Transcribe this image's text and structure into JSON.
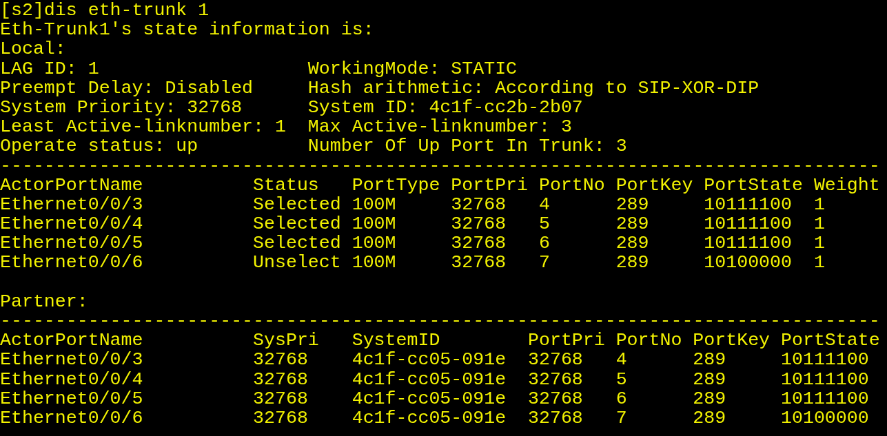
{
  "command": "[s2]dis eth-trunk 1",
  "header": "Eth-Trunk1's state information is:",
  "local_label": "Local:",
  "info": [
    {
      "left": "LAG ID: 1",
      "right": "WorkingMode: STATIC"
    },
    {
      "left": "Preempt Delay: Disabled",
      "right": "Hash arithmetic: According to SIP-XOR-DIP"
    },
    {
      "left": "System Priority: 32768",
      "right": "System ID: 4c1f-cc2b-2b07"
    },
    {
      "left": "Least Active-linknumber: 1",
      "right": "Max Active-linknumber: 3"
    },
    {
      "left": "Operate status: up",
      "right": "Number Of Up Port In Trunk: 3"
    }
  ],
  "local_table": {
    "separator": "--------------------------------------------------------------------------------",
    "columns": [
      "ActorPortName",
      "Status",
      "PortType",
      "PortPri",
      "PortNo",
      "PortKey",
      "PortState",
      "Weight"
    ],
    "rows": [
      [
        "Ethernet0/0/3",
        "Selected",
        "100M",
        "32768",
        "4",
        "289",
        "10111100",
        "1"
      ],
      [
        "Ethernet0/0/4",
        "Selected",
        "100M",
        "32768",
        "5",
        "289",
        "10111100",
        "1"
      ],
      [
        "Ethernet0/0/5",
        "Selected",
        "100M",
        "32768",
        "6",
        "289",
        "10111100",
        "1"
      ],
      [
        "Ethernet0/0/6",
        "Unselect",
        "100M",
        "32768",
        "7",
        "289",
        "10100000",
        "1"
      ]
    ]
  },
  "partner_label": "Partner:",
  "partner_table": {
    "separator": "--------------------------------------------------------------------------------",
    "columns": [
      "ActorPortName",
      "SysPri",
      "SystemID",
      "PortPri",
      "PortNo",
      "PortKey",
      "PortState"
    ],
    "rows": [
      [
        "Ethernet0/0/3",
        "32768",
        "4c1f-cc05-091e",
        "32768",
        "4",
        "289",
        "10111100"
      ],
      [
        "Ethernet0/0/4",
        "32768",
        "4c1f-cc05-091e",
        "32768",
        "5",
        "289",
        "10111100"
      ],
      [
        "Ethernet0/0/5",
        "32768",
        "4c1f-cc05-091e",
        "32768",
        "6",
        "289",
        "10111100"
      ],
      [
        "Ethernet0/0/6",
        "32768",
        "4c1f-cc05-091e",
        "32768",
        "7",
        "289",
        "10100000"
      ]
    ]
  }
}
